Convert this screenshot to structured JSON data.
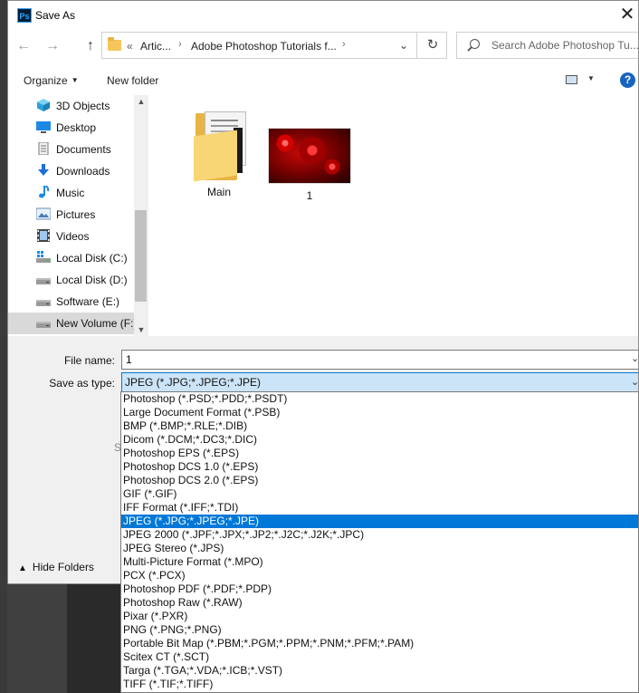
{
  "window": {
    "title": "Save As",
    "app_badge": "Ps",
    "close": "✕"
  },
  "address": {
    "chevrons": "«",
    "crumbs": [
      "Artic...",
      "Adobe Photoshop Tutorials f..."
    ],
    "separator": "›",
    "dropdown": "⌄",
    "refresh": "↻"
  },
  "search": {
    "placeholder": "Search Adobe Photoshop Tu..."
  },
  "toolbar": {
    "organize": "Organize",
    "new_folder": "New folder",
    "help": "?"
  },
  "nav": {
    "items": [
      {
        "label": "3D Objects",
        "icon": "3d-objects-icon"
      },
      {
        "label": "Desktop",
        "icon": "desktop-icon"
      },
      {
        "label": "Documents",
        "icon": "documents-icon"
      },
      {
        "label": "Downloads",
        "icon": "downloads-icon"
      },
      {
        "label": "Music",
        "icon": "music-icon"
      },
      {
        "label": "Pictures",
        "icon": "pictures-icon"
      },
      {
        "label": "Videos",
        "icon": "videos-icon"
      },
      {
        "label": "Local Disk (C:)",
        "icon": "drive-icon"
      },
      {
        "label": "Local Disk (D:)",
        "icon": "drive-icon"
      },
      {
        "label": "Software (E:)",
        "icon": "drive-icon"
      },
      {
        "label": "New Volume (F:)",
        "icon": "drive-icon",
        "selected": true
      }
    ]
  },
  "files": [
    {
      "name": "Main",
      "type": "folder"
    },
    {
      "name": "1",
      "type": "image"
    }
  ],
  "form": {
    "file_name_label": "File name:",
    "file_name_value": "1",
    "save_type_label": "Save as type:",
    "save_type_value": "JPEG (*.JPG;*.JPEG;*.JPE)",
    "obscured_letter": "S",
    "hide_folders": "Hide Folders"
  },
  "file_types": [
    "Photoshop (*.PSD;*.PDD;*.PSDT)",
    "Large Document Format (*.PSB)",
    "BMP (*.BMP;*.RLE;*.DIB)",
    "Dicom (*.DCM;*.DC3;*.DIC)",
    "Photoshop EPS (*.EPS)",
    "Photoshop DCS 1.0 (*.EPS)",
    "Photoshop DCS 2.0 (*.EPS)",
    "GIF (*.GIF)",
    "IFF Format (*.IFF;*.TDI)",
    "JPEG (*.JPG;*.JPEG;*.JPE)",
    "JPEG 2000 (*.JPF;*.JPX;*.JP2;*.J2C;*.J2K;*.JPC)",
    "JPEG Stereo (*.JPS)",
    "Multi-Picture Format (*.MPO)",
    "PCX (*.PCX)",
    "Photoshop PDF (*.PDF;*.PDP)",
    "Photoshop Raw (*.RAW)",
    "Pixar (*.PXR)",
    "PNG (*.PNG;*.PNG)",
    "Portable Bit Map (*.PBM;*.PGM;*.PPM;*.PNM;*.PFM;*.PAM)",
    "Scitex CT (*.SCT)",
    "Targa (*.TGA;*.VDA;*.ICB;*.VST)",
    "TIFF (*.TIF;*.TIFF)"
  ],
  "selected_file_type_index": 9,
  "colors": {
    "accent": "#0078d7",
    "selection_bg": "#cce4f7",
    "nav_selected": "#d9d9d9"
  }
}
